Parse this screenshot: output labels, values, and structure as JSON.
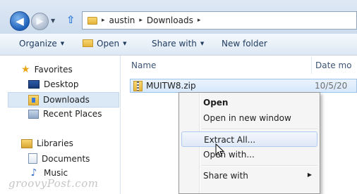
{
  "address": {
    "crumbs": [
      "austin",
      "Downloads"
    ],
    "sep": "▸"
  },
  "toolbar": {
    "organize": "Organize",
    "open": "Open",
    "share": "Share with",
    "new_folder": "New folder"
  },
  "nav": {
    "favorites": "Favorites",
    "desktop": "Desktop",
    "downloads": "Downloads",
    "recent": "Recent Places",
    "libraries": "Libraries",
    "documents": "Documents",
    "music": "Music"
  },
  "columns": {
    "name": "Name",
    "date": "Date mo"
  },
  "files": [
    {
      "name": "MUITW8.zip",
      "date": "10/5/20"
    }
  ],
  "context_menu": {
    "items": [
      "Open",
      "Open in new window",
      "Extract All...",
      "Open with...",
      "Share with"
    ]
  },
  "watermark": "groovyPost.com",
  "colors": {
    "selection": "#d6e8fb",
    "menu_hover": "#dfe9f7",
    "toolbar_text": "#1e3a5e"
  }
}
